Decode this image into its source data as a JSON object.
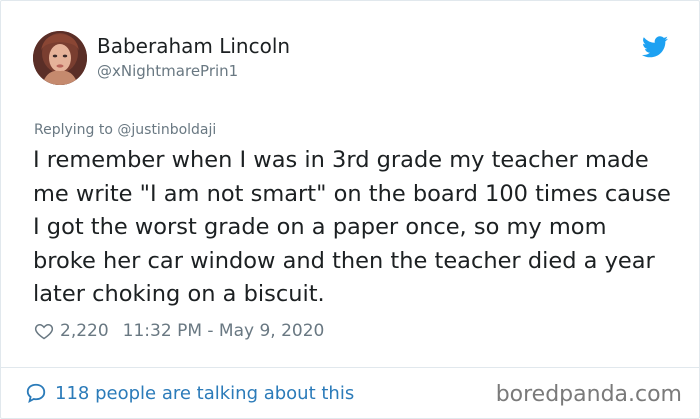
{
  "author": {
    "name": "Baberaham Lincoln",
    "handle": "@xNightmarePrin1",
    "avatar_icon": "user-avatar"
  },
  "brand": {
    "icon": "twitter-bird-icon",
    "color": "#1da1f2"
  },
  "reply": {
    "prefix": "Replying to",
    "mention": "@justinboldaji"
  },
  "tweet": {
    "text": "I remember when I was in 3rd grade my teacher made me write \"I am not smart\" on the board 100 times cause I got the worst grade on a paper once, so my mom broke her car window and then the teacher died a year later choking on a biscuit."
  },
  "meta": {
    "likes": "2,220",
    "timestamp": "11:32 PM - May 9, 2020",
    "heart_icon": "heart-icon"
  },
  "footer": {
    "talking_text": "118 people are talking about this",
    "bubble_icon": "speech-bubble-icon",
    "link_color": "#2b7bb9"
  },
  "watermark": {
    "text": "boredpanda.com"
  }
}
